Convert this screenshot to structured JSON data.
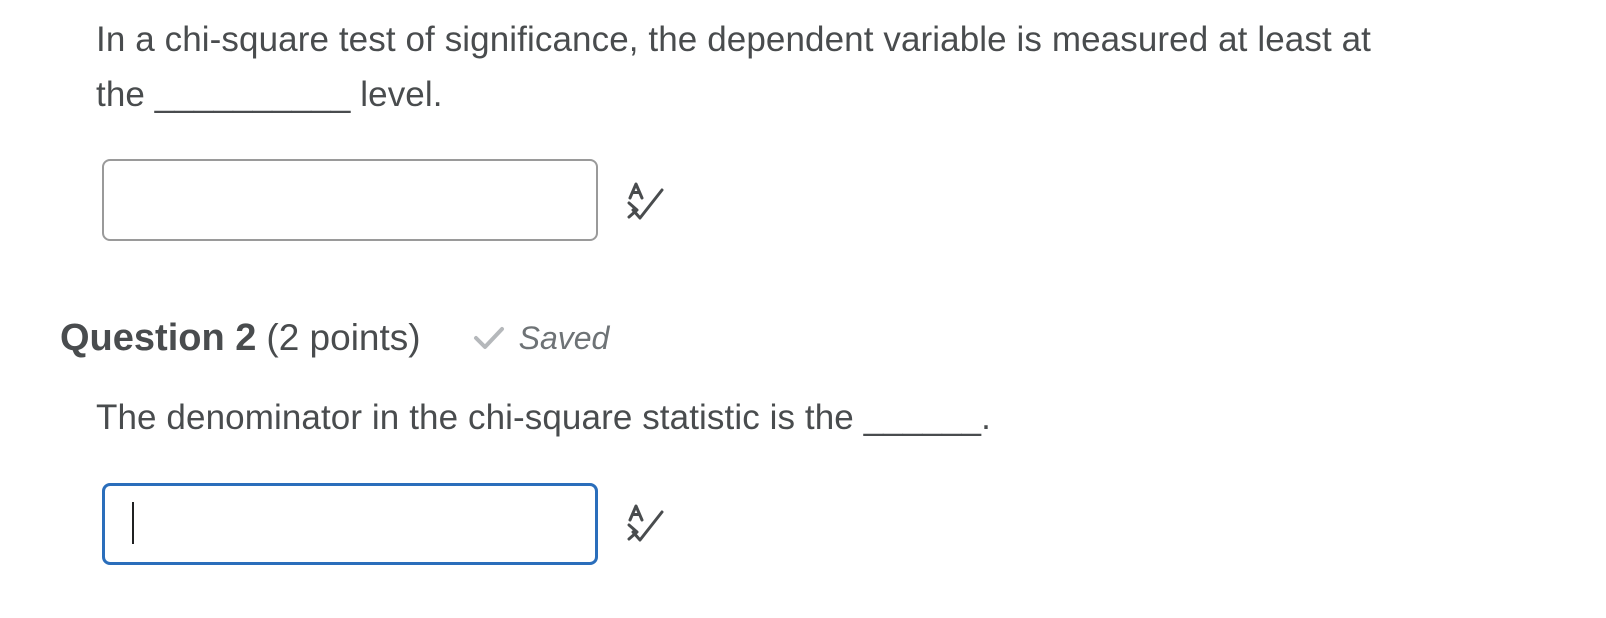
{
  "question1": {
    "text_line1": "In a chi-square test of significance, the dependent variable is measured at least at",
    "text_line2": "the __________ level.",
    "answer_value": "",
    "spellcheck_icon": "spellcheck-icon"
  },
  "question2": {
    "title": "Question 2",
    "points": "(2 points)",
    "status_icon": "check-icon",
    "status_text": "Saved",
    "text": "The denominator in the chi-square statistic is the ______.",
    "answer_value": "",
    "spellcheck_icon": "spellcheck-icon"
  },
  "colors": {
    "text": "#494c4e",
    "input_border": "#9a9a9a",
    "input_focus_border": "#2a6ebb",
    "saved_gray": "#6e7376",
    "check_gray": "#b5b8bb"
  }
}
